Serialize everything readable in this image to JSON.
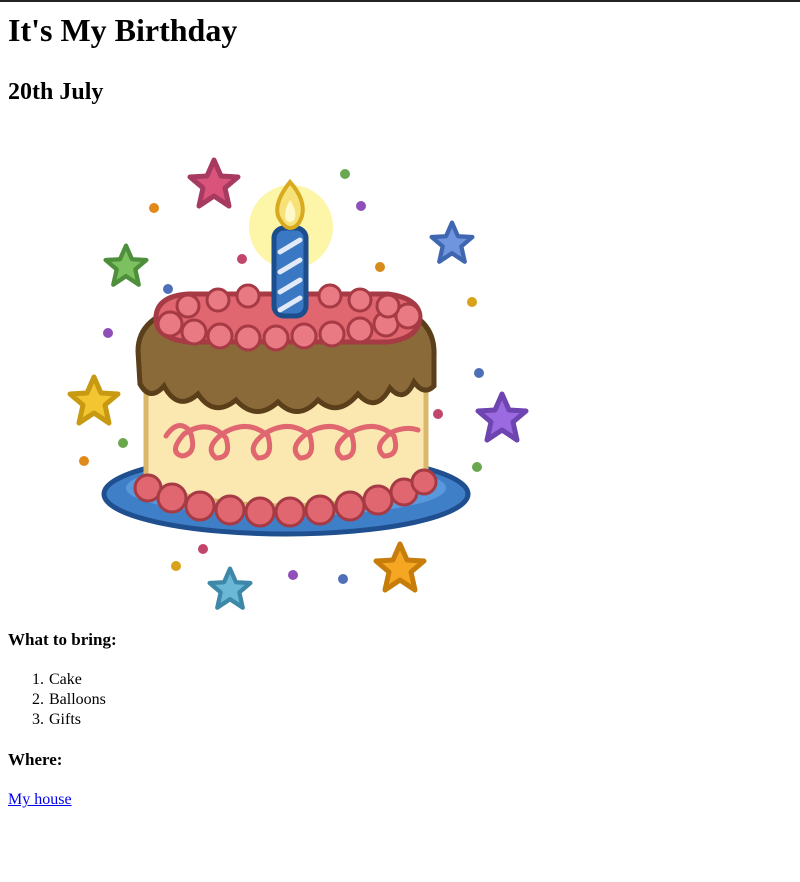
{
  "page": {
    "title": "It's My Birthday",
    "date": "20th July"
  },
  "image": {
    "icon": "birthday-cake-icon",
    "colors": {
      "frosting": "#e0666f",
      "chocolate": "#8b6a3a",
      "sponge": "#fbe7b0",
      "plate": "#3f7fc8",
      "candle": "#3a78c4",
      "flame": "#f7e27a"
    }
  },
  "bring": {
    "heading": "What to bring:",
    "items": [
      "Cake",
      "Balloons",
      "Gifts"
    ]
  },
  "where": {
    "heading": "Where:",
    "link_text": "My house"
  }
}
